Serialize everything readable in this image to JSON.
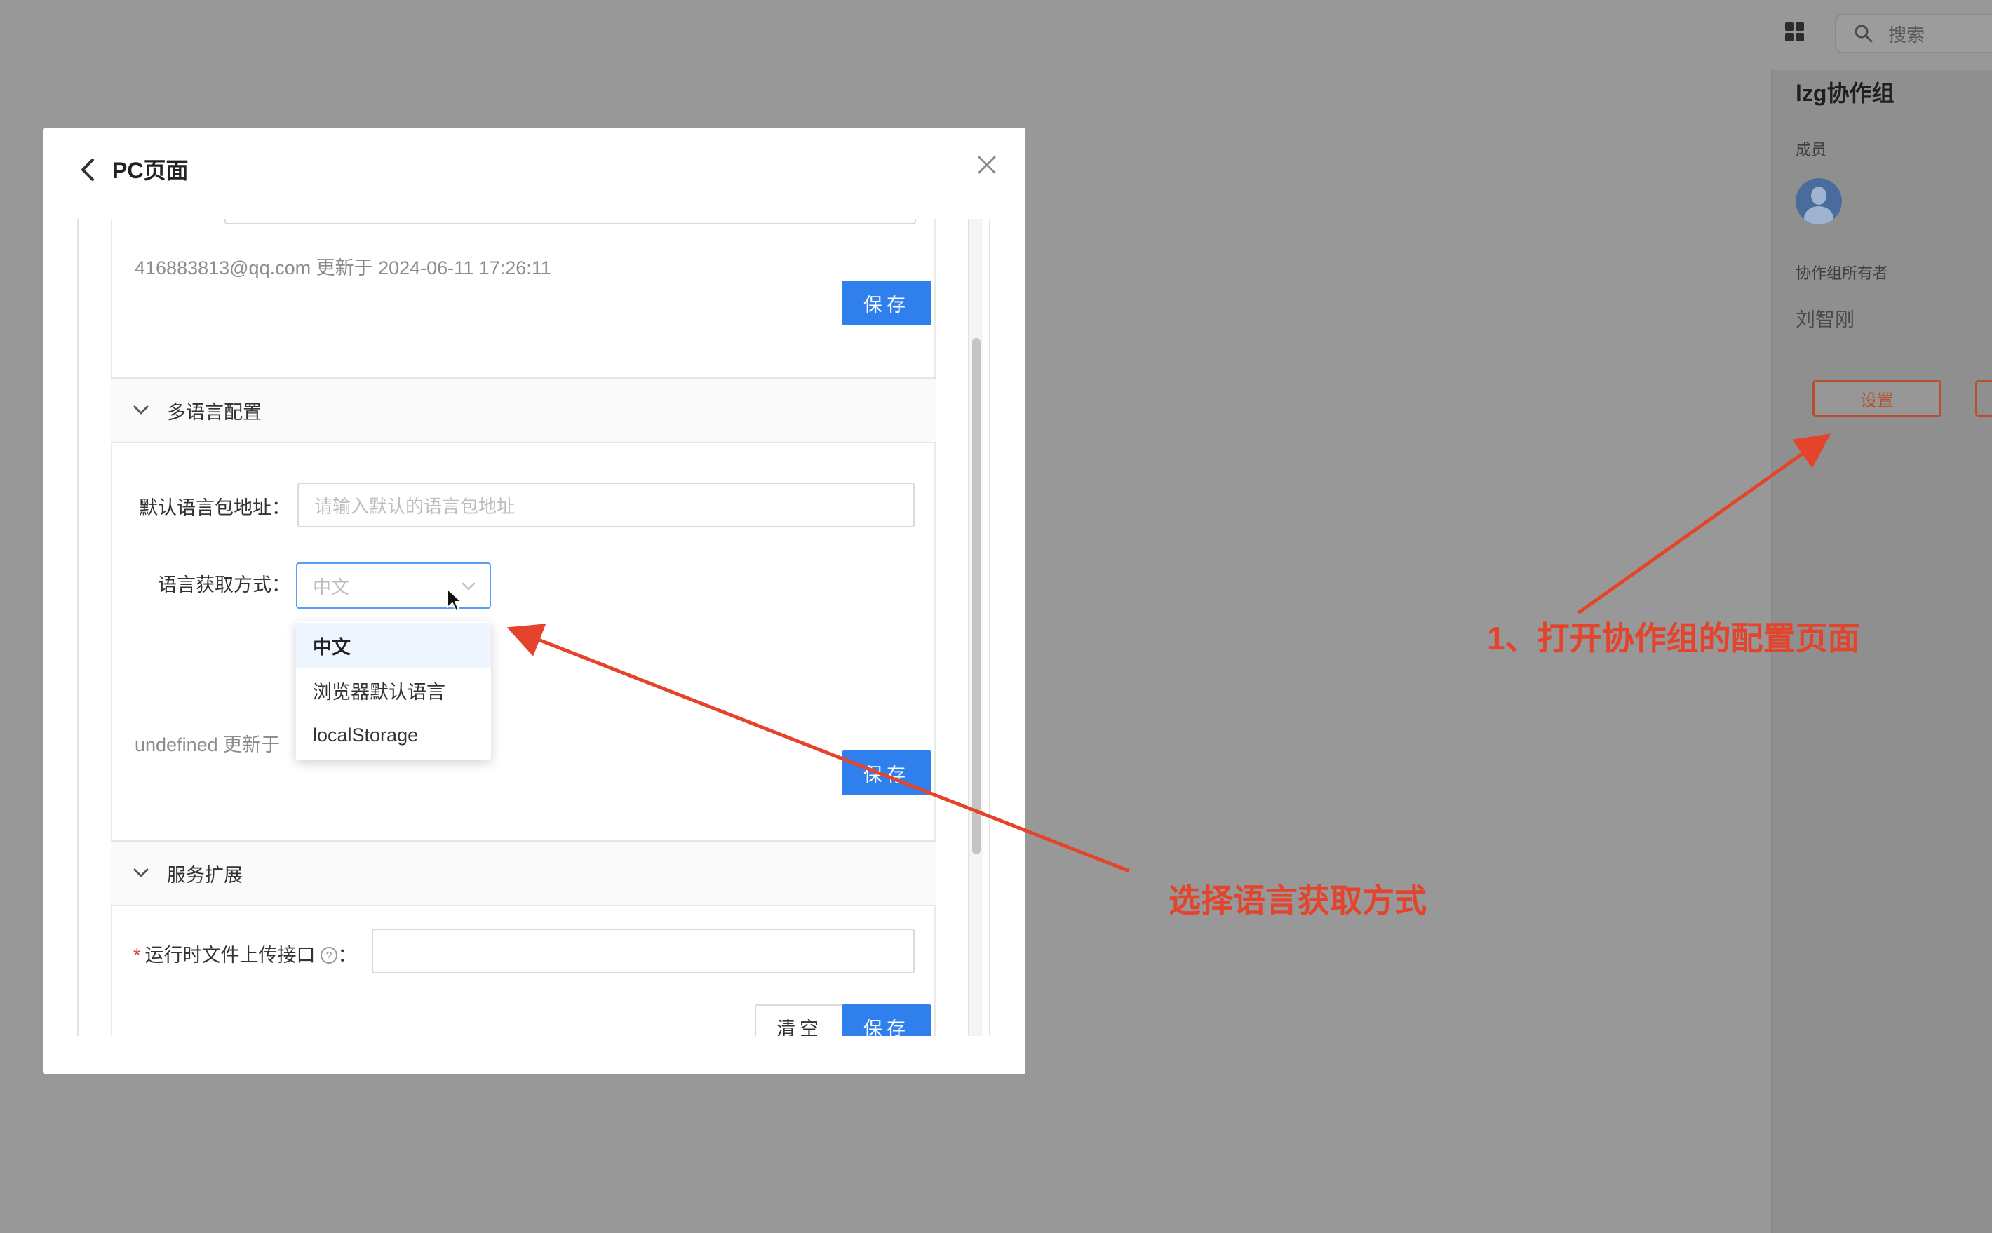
{
  "topbar": {
    "search_placeholder": "搜索",
    "apps_icon": "grid-icon",
    "search_icon": "search-icon"
  },
  "side_panel": {
    "group_title": "lzg协作组",
    "members_label": "成员",
    "owner_label": "协作组所有者",
    "owner_name": "刘智刚",
    "settings_button": "设置",
    "avatar_icon": "user-avatar-icon"
  },
  "modal": {
    "title": "PC页面",
    "back_icon": "chevron-left-icon",
    "close_icon": "close-icon",
    "sections": {
      "top": {
        "meta": "416883813@qq.com 更新于 2024-06-11 17:26:11",
        "save_label": "保存"
      },
      "i18n": {
        "header": "多语言配置",
        "default_pack_label": "默认语言包地址：",
        "default_pack_placeholder": "请输入默认的语言包地址",
        "lang_mode_label": "语言获取方式：",
        "lang_mode_value": "中文",
        "options": [
          "中文",
          "浏览器默认语言",
          "localStorage"
        ],
        "meta": "undefined 更新于",
        "save_label": "保存"
      },
      "service": {
        "header": "服务扩展",
        "upload_label": "运行时文件上传接口",
        "upload_colon": "：",
        "required_mark": "*",
        "clear_label": "清空",
        "save_label": "保存"
      }
    }
  },
  "annotations": {
    "step1": "1、打开协作组的配置页面",
    "step2": "选择语言获取方式",
    "color": "#e4442c"
  },
  "colors": {
    "primary": "#2f80ed",
    "backdrop": "#989898",
    "settings_accent": "#b5512d"
  }
}
